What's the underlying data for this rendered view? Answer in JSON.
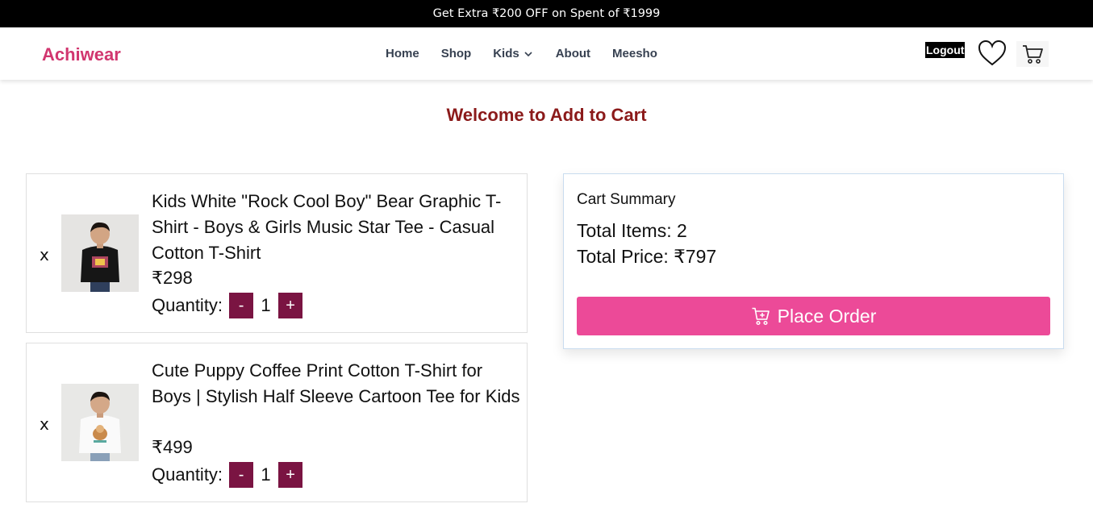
{
  "promo": {
    "text": "Get Extra ₹200 OFF on Spent of ₹1999"
  },
  "navbar": {
    "brand": "Achiwear",
    "links": [
      "Home",
      "Shop",
      "Kids",
      "About",
      "Meesho"
    ],
    "logout_label": "Logout",
    "icons": {
      "wishlist": "heart-icon",
      "cart": "cart-icon",
      "dropdown": "chevron-down-icon"
    }
  },
  "page": {
    "title": "Welcome to Add to Cart"
  },
  "cart": {
    "remove_label": "x",
    "quantity_label": "Quantity:",
    "decrement_label": "-",
    "increment_label": "+",
    "items": [
      {
        "title": "Kids White \"Rock Cool Boy\" Bear Graphic T-Shirt - Boys & Girls Music Star Tee - Casual Cotton T-Shirt",
        "price": "₹298",
        "quantity": "1"
      },
      {
        "title": "Cute Puppy Coffee Print Cotton T-Shirt for Boys | Stylish Half Sleeve Cartoon Tee for Kids",
        "price": "₹499",
        "quantity": "1"
      }
    ]
  },
  "summary": {
    "heading": "Cart Summary",
    "total_items": "Total Items: 2",
    "total_price": "Total Price: ₹797",
    "place_order_label": "Place Order"
  },
  "colors": {
    "brand": "#d1366f",
    "title": "#8b1a1a",
    "qty_button": "#7a1442",
    "place_order": "#ec4a98"
  }
}
